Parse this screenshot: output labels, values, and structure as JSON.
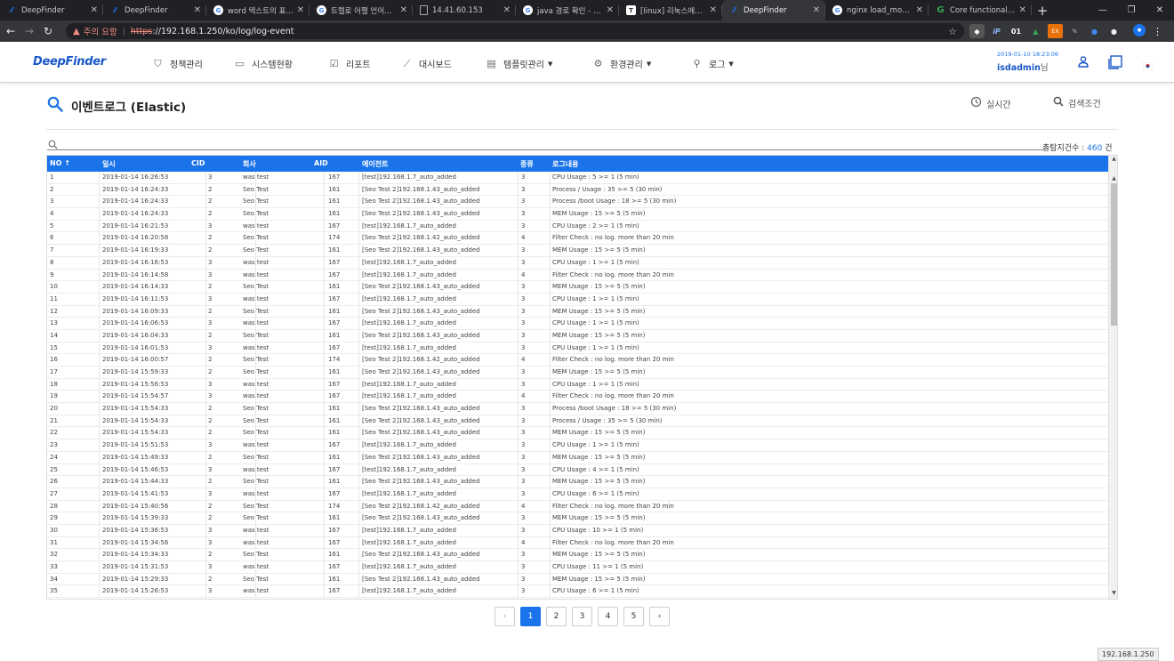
{
  "browser": {
    "tabs": [
      {
        "title": "DeepFinder",
        "icon": "deepfinder-icon",
        "color": "#1a73e8",
        "active": false
      },
      {
        "title": "DeepFinder",
        "icon": "deepfinder-icon",
        "color": "#1a73e8",
        "active": false
      },
      {
        "title": "word 텍스트의 표...",
        "icon": "google-icon",
        "color": "#4285f4",
        "active": false
      },
      {
        "title": "트렐로 어쩔 언어...",
        "icon": "google-icon",
        "color": "#4285f4",
        "active": false
      },
      {
        "title": "14.41.60.153",
        "icon": "page-icon",
        "color": "#777777",
        "active": false
      },
      {
        "title": "java 경로 확인 - G...",
        "icon": "google-icon",
        "color": "#4285f4",
        "active": false
      },
      {
        "title": "[linux] 리눅스에서...",
        "icon": "tistory-icon",
        "color": "#555555",
        "active": false
      },
      {
        "title": "DeepFinder",
        "icon": "deepfinder-icon",
        "color": "#1a73e8",
        "active": true
      },
      {
        "title": "nginx load_module...",
        "icon": "google-icon",
        "color": "#4285f4",
        "active": false
      },
      {
        "title": "Core functionality",
        "icon": "g-green-icon",
        "color": "#34a853",
        "active": false
      }
    ],
    "warning": "주의 요함",
    "url_scheme": "https",
    "url_rest": "://192.168.1.250/ko/log/log-event",
    "ext_badge": "01"
  },
  "app": {
    "logo": "DeepFinder",
    "menu": [
      {
        "label": "정책관리",
        "icon": "shield-icon",
        "caret": false
      },
      {
        "label": "시스템현황",
        "icon": "monitor-icon",
        "caret": false
      },
      {
        "label": "리포트",
        "icon": "checkbox-icon",
        "caret": false
      },
      {
        "label": "대시보드",
        "icon": "chart-line-icon",
        "caret": false
      },
      {
        "label": "템플릿관리",
        "icon": "template-icon",
        "caret": true
      },
      {
        "label": "환경관리",
        "icon": "gear-icon",
        "caret": true
      },
      {
        "label": "로그",
        "icon": "search-icon",
        "caret": true
      }
    ],
    "datetime": "2019-01-10 18:23:06",
    "username": "isdadmin",
    "user_suffix": "님"
  },
  "page": {
    "title": "이벤트로그 (Elastic)",
    "realtime_label": "실시간",
    "search_cond_label": "검색조건",
    "count_label": "총탐지건수 :",
    "count_value": "460",
    "count_unit": "건"
  },
  "table": {
    "headers": [
      "NO ↑",
      "일시",
      "CID",
      "회사",
      "AID",
      "에이전트",
      "종류",
      "로그내용"
    ],
    "rows": [
      [
        "1",
        "2019-01-14 16:26:53",
        "3",
        "was test",
        "167",
        "[test]192.168.1.7_auto_added",
        "3",
        "CPU Usage : 5 >= 1 (5 min)"
      ],
      [
        "2",
        "2019-01-14 16:24:33",
        "2",
        "Seo Test",
        "161",
        "[Seo Test 2]192.168.1.43_auto_added",
        "3",
        "Process / Usage : 35 >= 5 (30 min)"
      ],
      [
        "3",
        "2019-01-14 16:24:33",
        "2",
        "Seo Test",
        "161",
        "[Seo Test 2]192.168.1.43_auto_added",
        "3",
        "Process /boot Usage : 18 >= 5 (30 min)"
      ],
      [
        "4",
        "2019-01-14 16:24:33",
        "2",
        "Seo Test",
        "161",
        "[Seo Test 2]192.168.1.43_auto_added",
        "3",
        "MEM Usage : 15 >= 5 (5 min)"
      ],
      [
        "5",
        "2019-01-14 16:21:53",
        "3",
        "was test",
        "167",
        "[test]192.168.1.7_auto_added",
        "3",
        "CPU Usage : 2 >= 1 (5 min)"
      ],
      [
        "6",
        "2019-01-14 16:20:58",
        "2",
        "Seo Test",
        "174",
        "[Seo Test 2]192.168.1.42_auto_added",
        "4",
        "Filter Check : no log. more than 20 min"
      ],
      [
        "7",
        "2019-01-14 16:19:33",
        "2",
        "Seo Test",
        "161",
        "[Seo Test 2]192.168.1.43_auto_added",
        "3",
        "MEM Usage : 15 >= 5 (5 min)"
      ],
      [
        "8",
        "2019-01-14 16:16:53",
        "3",
        "was test",
        "167",
        "[test]192.168.1.7_auto_added",
        "3",
        "CPU Usage : 1 >= 1 (5 min)"
      ],
      [
        "9",
        "2019-01-14 16:14:58",
        "3",
        "was test",
        "167",
        "[test]192.168.1.7_auto_added",
        "4",
        "Filter Check : no log. more than 20 min"
      ],
      [
        "10",
        "2019-01-14 16:14:33",
        "2",
        "Seo Test",
        "161",
        "[Seo Test 2]192.168.1.43_auto_added",
        "3",
        "MEM Usage : 15 >= 5 (5 min)"
      ],
      [
        "11",
        "2019-01-14 16:11:53",
        "3",
        "was test",
        "167",
        "[test]192.168.1.7_auto_added",
        "3",
        "CPU Usage : 1 >= 1 (5 min)"
      ],
      [
        "12",
        "2019-01-14 16:09:33",
        "2",
        "Seo Test",
        "161",
        "[Seo Test 2]192.168.1.43_auto_added",
        "3",
        "MEM Usage : 15 >= 5 (5 min)"
      ],
      [
        "13",
        "2019-01-14 16:06:53",
        "3",
        "was test",
        "167",
        "[test]192.168.1.7_auto_added",
        "3",
        "CPU Usage : 1 >= 1 (5 min)"
      ],
      [
        "14",
        "2019-01-14 16:04:33",
        "2",
        "Seo Test",
        "161",
        "[Seo Test 2]192.168.1.43_auto_added",
        "3",
        "MEM Usage : 15 >= 5 (5 min)"
      ],
      [
        "15",
        "2019-01-14 16:01:53",
        "3",
        "was test",
        "167",
        "[test]192.168.1.7_auto_added",
        "3",
        "CPU Usage : 1 >= 1 (5 min)"
      ],
      [
        "16",
        "2019-01-14 16:00:57",
        "2",
        "Seo Test",
        "174",
        "[Seo Test 2]192.168.1.42_auto_added",
        "4",
        "Filter Check : no log. more than 20 min"
      ],
      [
        "17",
        "2019-01-14 15:59:33",
        "2",
        "Seo Test",
        "161",
        "[Seo Test 2]192.168.1.43_auto_added",
        "3",
        "MEM Usage : 15 >= 5 (5 min)"
      ],
      [
        "18",
        "2019-01-14 15:56:53",
        "3",
        "was test",
        "167",
        "[test]192.168.1.7_auto_added",
        "3",
        "CPU Usage : 1 >= 1 (5 min)"
      ],
      [
        "19",
        "2019-01-14 15:54:57",
        "3",
        "was test",
        "167",
        "[test]192.168.1.7_auto_added",
        "4",
        "Filter Check : no log. more than 20 min"
      ],
      [
        "20",
        "2019-01-14 15:54:33",
        "2",
        "Seo Test",
        "161",
        "[Seo Test 2]192.168.1.43_auto_added",
        "3",
        "Process /boot Usage : 18 >= 5 (30 min)"
      ],
      [
        "21",
        "2019-01-14 15:54:33",
        "2",
        "Seo Test",
        "161",
        "[Seo Test 2]192.168.1.43_auto_added",
        "3",
        "Process / Usage : 35 >= 5 (30 min)"
      ],
      [
        "22",
        "2019-01-14 15:54:33",
        "2",
        "Seo Test",
        "161",
        "[Seo Test 2]192.168.1.43_auto_added",
        "3",
        "MEM Usage : 15 >= 5 (5 min)"
      ],
      [
        "23",
        "2019-01-14 15:51:53",
        "3",
        "was test",
        "167",
        "[test]192.168.1.7_auto_added",
        "3",
        "CPU Usage : 1 >= 1 (5 min)"
      ],
      [
        "24",
        "2019-01-14 15:49:33",
        "2",
        "Seo Test",
        "161",
        "[Seo Test 2]192.168.1.43_auto_added",
        "3",
        "MEM Usage : 15 >= 5 (5 min)"
      ],
      [
        "25",
        "2019-01-14 15:46:53",
        "3",
        "was test",
        "167",
        "[test]192.168.1.7_auto_added",
        "3",
        "CPU Usage : 4 >= 1 (5 min)"
      ],
      [
        "26",
        "2019-01-14 15:44:33",
        "2",
        "Seo Test",
        "161",
        "[Seo Test 2]192.168.1.43_auto_added",
        "3",
        "MEM Usage : 15 >= 5 (5 min)"
      ],
      [
        "27",
        "2019-01-14 15:41:53",
        "3",
        "was test",
        "167",
        "[test]192.168.1.7_auto_added",
        "3",
        "CPU Usage : 6 >= 1 (5 min)"
      ],
      [
        "28",
        "2019-01-14 15:40:56",
        "2",
        "Seo Test",
        "174",
        "[Seo Test 2]192.168.1.42_auto_added",
        "4",
        "Filter Check : no log. more than 20 min"
      ],
      [
        "29",
        "2019-01-14 15:39:33",
        "2",
        "Seo Test",
        "161",
        "[Seo Test 2]192.168.1.43_auto_added",
        "3",
        "MEM Usage : 15 >= 5 (5 min)"
      ],
      [
        "30",
        "2019-01-14 15:36:53",
        "3",
        "was test",
        "167",
        "[test]192.168.1.7_auto_added",
        "3",
        "CPU Usage : 10 >= 1 (5 min)"
      ],
      [
        "31",
        "2019-01-14 15:34:56",
        "3",
        "was test",
        "167",
        "[test]192.168.1.7_auto_added",
        "4",
        "Filter Check : no log. more than 20 min"
      ],
      [
        "32",
        "2019-01-14 15:34:33",
        "2",
        "Seo Test",
        "161",
        "[Seo Test 2]192.168.1.43_auto_added",
        "3",
        "MEM Usage : 15 >= 5 (5 min)"
      ],
      [
        "33",
        "2019-01-14 15:31:53",
        "3",
        "was test",
        "167",
        "[test]192.168.1.7_auto_added",
        "3",
        "CPU Usage : 11 >= 1 (5 min)"
      ],
      [
        "34",
        "2019-01-14 15:29:33",
        "2",
        "Seo Test",
        "161",
        "[Seo Test 2]192.168.1.43_auto_added",
        "3",
        "MEM Usage : 15 >= 5 (5 min)"
      ],
      [
        "35",
        "2019-01-14 15:26:53",
        "3",
        "was test",
        "167",
        "[test]192.168.1.7_auto_added",
        "3",
        "CPU Usage : 6 >= 1 (5 min)"
      ]
    ]
  },
  "pagination": {
    "pages": [
      "1",
      "2",
      "3",
      "4",
      "5"
    ],
    "current": "1",
    "prev": "‹",
    "next": "›"
  },
  "status": {
    "hover_url": "192.168.1.250"
  },
  "colors": {
    "accent": "#1a73e8",
    "brand": "#1a58c9",
    "warning": "#f28b82"
  }
}
